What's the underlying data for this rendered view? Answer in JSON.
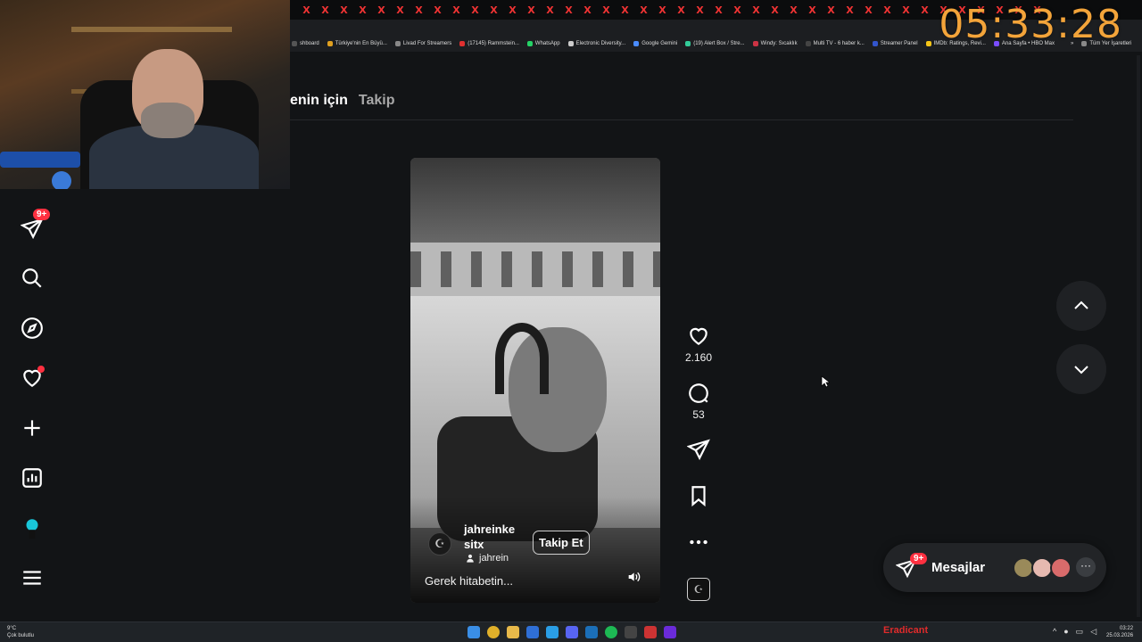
{
  "browser": {
    "tab_close_glyph": "X",
    "bookmarks": [
      {
        "label": "shboard",
        "color": "#555555"
      },
      {
        "label": "Türkiye'nin En Büyü...",
        "color": "#e0a020"
      },
      {
        "label": "Livad For Streamers",
        "color": "#888888"
      },
      {
        "label": "(17145) Rammstein...",
        "color": "#e03030"
      },
      {
        "label": "WhatsApp",
        "color": "#25d366"
      },
      {
        "label": "Electronic Diversity...",
        "color": "#cccccc"
      },
      {
        "label": "Google Gemini",
        "color": "#4a8cff"
      },
      {
        "label": "(19) Alert Box / Stre...",
        "color": "#33cc99"
      },
      {
        "label": "Windy: Sıcaklık",
        "color": "#cc3344"
      },
      {
        "label": "Multi TV - 6 haber k...",
        "color": "#444444"
      },
      {
        "label": "Streamer Panel",
        "color": "#3355cc"
      },
      {
        "label": "IMDb: Ratings, Revi...",
        "color": "#f5c518"
      },
      {
        "label": "Ana Sayfa • HBO Max",
        "color": "#7a4dff"
      },
      {
        "label": "»",
        "color": "#1c1e21"
      },
      {
        "label": "Tüm Yer İşaretleri",
        "color": "#888888"
      }
    ]
  },
  "overlay": {
    "clock": "05:33:28"
  },
  "sidebar": {
    "notification_badge": "9+"
  },
  "feed": {
    "tabs": [
      {
        "label": "enin için",
        "active": true
      },
      {
        "label": "Takip",
        "active": false
      }
    ]
  },
  "reel": {
    "username": "jahreinke sitx",
    "follow_label": "Takip Et",
    "audio": "jahrein",
    "caption": "Gerek hitabetin...",
    "likes": "2.160",
    "comments": "53"
  },
  "messages": {
    "label": "Mesajlar",
    "badge": "9+",
    "more": "···"
  },
  "taskbar": {
    "weather_temp": "9°C",
    "weather_desc": "Çok bulutlu",
    "streamer_name": "Eradicant",
    "time": "03:22",
    "date": "25.03.2026"
  },
  "colors": {
    "accent_red": "#ff3040",
    "clock_orange": "#f3a43a",
    "background": "#121416"
  }
}
